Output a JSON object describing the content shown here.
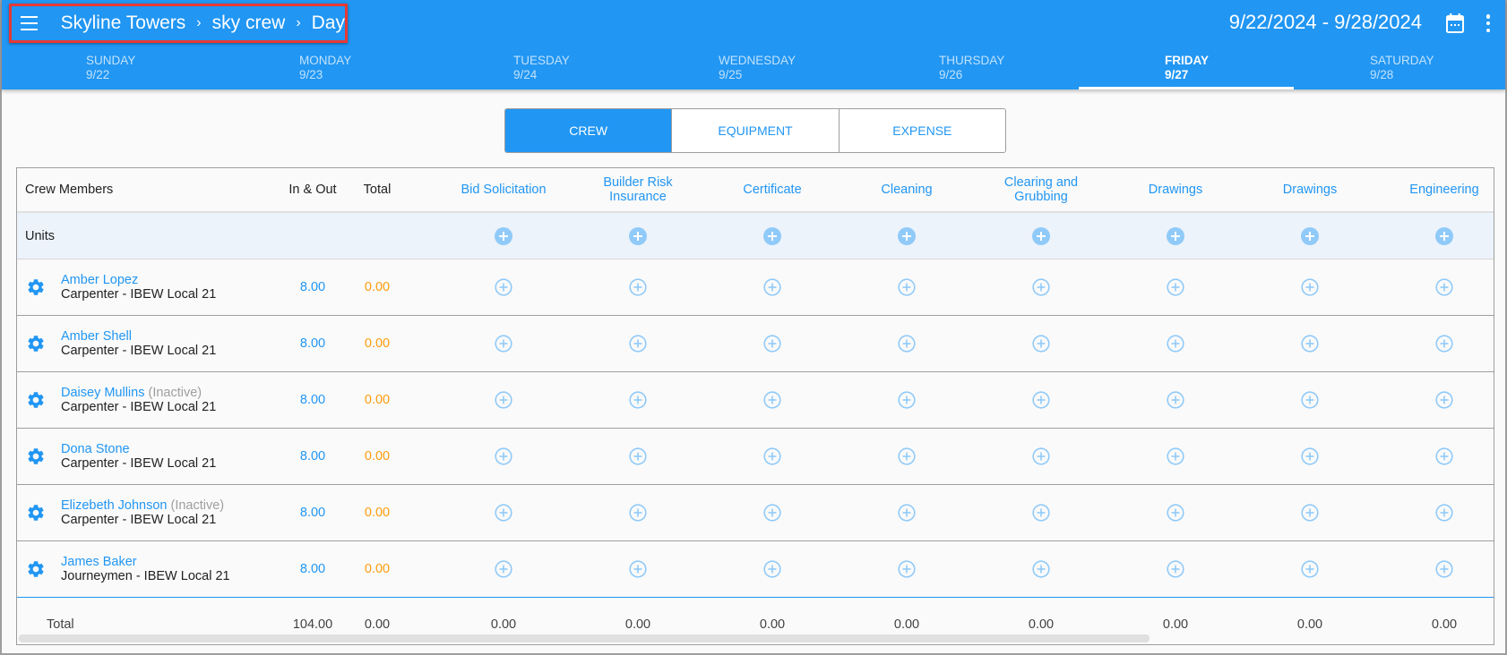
{
  "header": {
    "breadcrumb": [
      "Skyline Towers",
      "sky crew",
      "Day"
    ],
    "date_range": "9/22/2024 - 9/28/2024",
    "icons": {
      "menu": "menu-icon",
      "calendar": "calendar-icon",
      "more": "more-vert-icon",
      "separator": "chevron-right-icon"
    },
    "separator_glyph": "›"
  },
  "day_tabs": [
    {
      "day": "SUNDAY",
      "date": "9/22",
      "active": false
    },
    {
      "day": "MONDAY",
      "date": "9/23",
      "active": false
    },
    {
      "day": "TUESDAY",
      "date": "9/24",
      "active": false
    },
    {
      "day": "WEDNESDAY",
      "date": "9/25",
      "active": false
    },
    {
      "day": "THURSDAY",
      "date": "9/26",
      "active": false
    },
    {
      "day": "FRIDAY",
      "date": "9/27",
      "active": true
    },
    {
      "day": "SATURDAY",
      "date": "9/28",
      "active": false
    }
  ],
  "segments": [
    {
      "label": "CREW",
      "active": true
    },
    {
      "label": "EQUIPMENT",
      "active": false
    },
    {
      "label": "EXPENSE",
      "active": false
    }
  ],
  "table": {
    "headers": {
      "crew_members": "Crew Members",
      "in_out": "In & Out",
      "total": "Total",
      "cost_codes": [
        "Bid Solicitation",
        "Builder Risk Insurance",
        "Certificate",
        "Cleaning",
        "Clearing and Grubbing",
        "Drawings",
        "Drawings",
        "Engineering"
      ]
    },
    "units_label": "Units",
    "rows": [
      {
        "name": "Amber Lopez",
        "status": "",
        "role": "Carpenter - IBEW Local 21",
        "in_out": "8.00",
        "total": "0.00"
      },
      {
        "name": "Amber Shell",
        "status": "",
        "role": "Carpenter - IBEW Local 21",
        "in_out": "8.00",
        "total": "0.00"
      },
      {
        "name": "Daisey Mullins",
        "status": "(Inactive)",
        "role": "Carpenter - IBEW Local 21",
        "in_out": "8.00",
        "total": "0.00"
      },
      {
        "name": "Dona Stone",
        "status": "",
        "role": "Carpenter - IBEW Local 21",
        "in_out": "8.00",
        "total": "0.00"
      },
      {
        "name": "Elizebeth Johnson",
        "status": "(Inactive)",
        "role": "Carpenter - IBEW Local 21",
        "in_out": "8.00",
        "total": "0.00"
      },
      {
        "name": "James Baker",
        "status": "",
        "role": "Journeymen - IBEW Local 21",
        "in_out": "8.00",
        "total": "0.00"
      }
    ],
    "totals": {
      "label": "Total",
      "in_out": "104.00",
      "total": "0.00",
      "cost_codes": [
        "0.00",
        "0.00",
        "0.00",
        "0.00",
        "0.00",
        "0.00",
        "0.00",
        "0.00"
      ]
    }
  },
  "colors": {
    "primary": "#2196f3",
    "orange": "#fb9c0c",
    "plus_light": "#90caf9",
    "highlight_box": "#e53935"
  }
}
